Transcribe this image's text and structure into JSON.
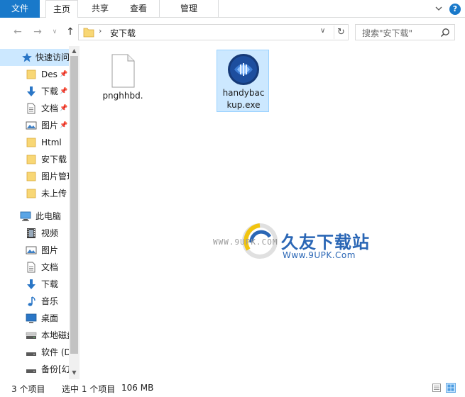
{
  "ribbon": {
    "tabs": [
      {
        "label": "文件",
        "active": false,
        "color": "#1979ca"
      },
      {
        "label": "主页",
        "active": true
      },
      {
        "label": "共享",
        "active": false
      },
      {
        "label": "查看",
        "active": false
      },
      {
        "label": "管理",
        "active": false
      }
    ],
    "help": "?"
  },
  "address": {
    "path": "安下载",
    "search_placeholder": "搜索\"安下载\""
  },
  "nav": {
    "items": [
      {
        "label": "快速访问",
        "icon": "star-icon",
        "selected": true,
        "pinned": false
      },
      {
        "label": "Des",
        "icon": "folder-icon",
        "selected": false,
        "pinned": true
      },
      {
        "label": "下载",
        "icon": "download-icon",
        "selected": false,
        "pinned": true
      },
      {
        "label": "文档",
        "icon": "document-icon",
        "selected": false,
        "pinned": true
      },
      {
        "label": "图片",
        "icon": "picture-icon",
        "selected": false,
        "pinned": true
      },
      {
        "label": "Html",
        "icon": "folder-icon",
        "selected": false,
        "pinned": false
      },
      {
        "label": "安下载",
        "icon": "folder-icon",
        "selected": false,
        "pinned": false
      },
      {
        "label": "图片管理",
        "icon": "folder-icon",
        "selected": false,
        "pinned": false
      },
      {
        "label": "未上传",
        "icon": "folder-icon",
        "selected": false,
        "pinned": false
      },
      {
        "label": "此电脑",
        "icon": "computer-icon",
        "selected": false,
        "pinned": false
      },
      {
        "label": "视频",
        "icon": "video-icon",
        "selected": false,
        "pinned": false
      },
      {
        "label": "图片",
        "icon": "picture-icon",
        "selected": false,
        "pinned": false
      },
      {
        "label": "文档",
        "icon": "document-icon",
        "selected": false,
        "pinned": false
      },
      {
        "label": "下载",
        "icon": "download-icon",
        "selected": false,
        "pinned": false
      },
      {
        "label": "音乐",
        "icon": "music-icon",
        "selected": false,
        "pinned": false
      },
      {
        "label": "桌面",
        "icon": "desktop-icon",
        "selected": false,
        "pinned": false
      },
      {
        "label": "本地磁盘",
        "icon": "drive-icon",
        "selected": false,
        "pinned": false
      },
      {
        "label": "软件 (D",
        "icon": "drive-icon",
        "selected": false,
        "pinned": false
      },
      {
        "label": "备份[幻",
        "icon": "drive-icon",
        "selected": false,
        "pinned": false
      }
    ]
  },
  "files": [
    {
      "name": "pnghhbd.",
      "icon": "blank-file-icon",
      "selected": false
    },
    {
      "name": "handybackup.exe",
      "name_lines": [
        "handybac",
        "kup.exe"
      ],
      "icon": "handybackup-app-icon",
      "selected": true
    }
  ],
  "watermark": {
    "small": "WWW.9UPK.COM",
    "title": "久友下载站",
    "url": "Www.9UPK.Com"
  },
  "status": {
    "count": "3 个项目",
    "selection": "选中 1 个项目",
    "size": "106 MB"
  },
  "colors": {
    "accent": "#1979ca",
    "selection": "#cce8ff",
    "folder": "#f8d775"
  }
}
